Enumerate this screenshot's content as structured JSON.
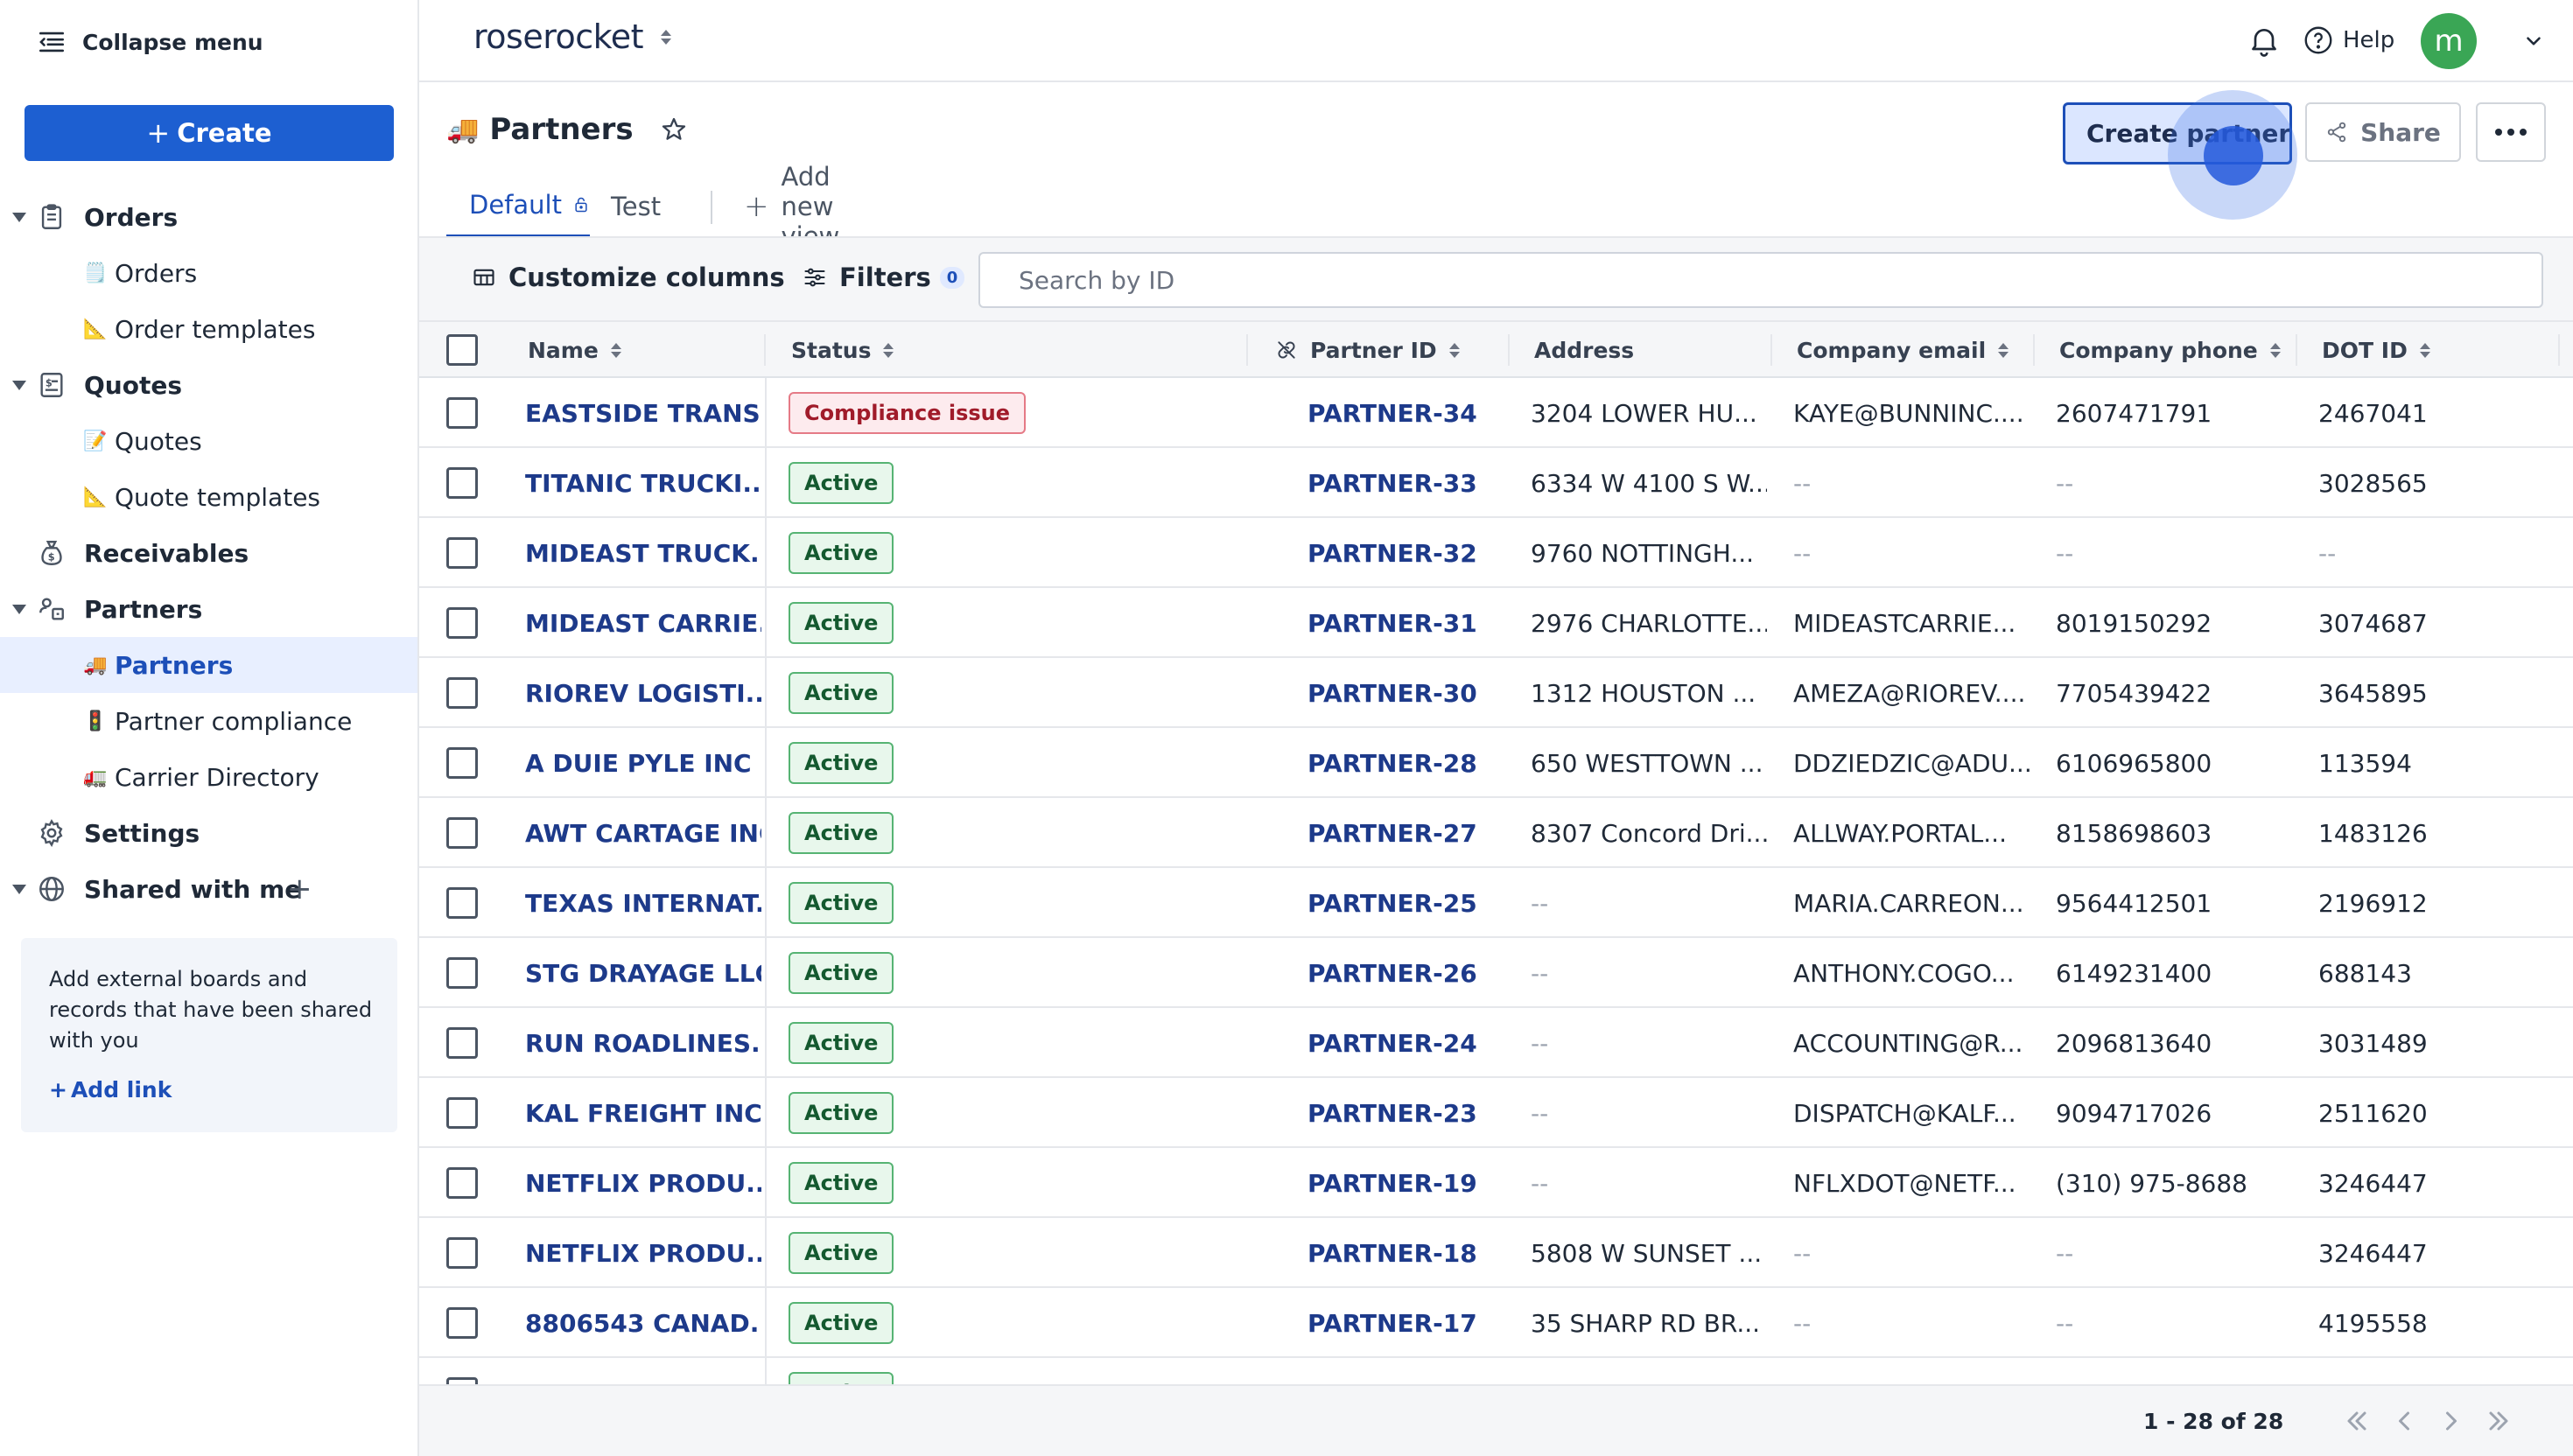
{
  "sidebar": {
    "collapse_label": "Collapse menu",
    "create_label": "Create",
    "groups": {
      "orders": {
        "label": "Orders",
        "items": [
          {
            "emoji": "🗒️",
            "label": "Orders"
          },
          {
            "emoji": "📐",
            "label": "Order templates"
          }
        ]
      },
      "quotes": {
        "label": "Quotes",
        "items": [
          {
            "emoji": "📝",
            "label": "Quotes"
          },
          {
            "emoji": "📐",
            "label": "Quote templates"
          }
        ]
      },
      "receivables": {
        "label": "Receivables"
      },
      "partners": {
        "label": "Partners",
        "items": [
          {
            "emoji": "🚚",
            "label": "Partners"
          },
          {
            "emoji": "🚦",
            "label": "Partner compliance"
          },
          {
            "emoji": "🚛",
            "label": "Carrier Directory"
          }
        ]
      },
      "settings": {
        "label": "Settings"
      },
      "shared": {
        "label": "Shared with me"
      }
    },
    "shared_box": {
      "text": "Add external boards and records that have been shared with you",
      "add_link": "Add link"
    }
  },
  "topbar": {
    "brand": "roserocket",
    "help_label": "Help",
    "avatar_initial": "m",
    "avatar_color": "#3aa655"
  },
  "page": {
    "emoji": "🚚",
    "title": "Partners",
    "create_partner_label": "Create partner",
    "share_label": "Share"
  },
  "tabs": {
    "default_label": "Default",
    "test_label": "Test",
    "add_view_label": "Add new view"
  },
  "toolbar": {
    "customize_label": "Customize columns",
    "filters_label": "Filters",
    "filters_count": "0",
    "search_placeholder": "Search by ID"
  },
  "table": {
    "columns": {
      "name": "Name",
      "status": "Status",
      "partner_id": "Partner ID",
      "address": "Address",
      "email": "Company email",
      "phone": "Company phone",
      "dot": "DOT ID"
    },
    "rows": [
      {
        "name": "EASTSIDE TRANS...",
        "status": "Compliance issue",
        "status_kind": "issue",
        "partner_id": "PARTNER-34",
        "address": "3204 LOWER HU...",
        "email": "KAYE@BUNNINC....",
        "phone": "2607471791",
        "dot": "2467041"
      },
      {
        "name": "TITANIC TRUCKI...",
        "status": "Active",
        "status_kind": "active",
        "partner_id": "PARTNER-33",
        "address": "6334 W 4100 S W...",
        "email": "--",
        "phone": "--",
        "dot": "3028565"
      },
      {
        "name": "MIDEAST TRUCK...",
        "status": "Active",
        "status_kind": "active",
        "partner_id": "PARTNER-32",
        "address": "9760 NOTTINGH...",
        "email": "--",
        "phone": "--",
        "dot": "--"
      },
      {
        "name": "MIDEAST CARRIE...",
        "status": "Active",
        "status_kind": "active",
        "partner_id": "PARTNER-31",
        "address": "2976 CHARLOTTE...",
        "email": "MIDEASTCARRIE...",
        "phone": "8019150292",
        "dot": "3074687"
      },
      {
        "name": "RIOREV LOGISTI...",
        "status": "Active",
        "status_kind": "active",
        "partner_id": "PARTNER-30",
        "address": "1312 HOUSTON ...",
        "email": "AMEZA@RIOREV....",
        "phone": "7705439422",
        "dot": "3645895"
      },
      {
        "name": "A DUIE PYLE INC",
        "status": "Active",
        "status_kind": "active",
        "partner_id": "PARTNER-28",
        "address": "650 WESTTOWN ...",
        "email": "DDZIEDZIC@ADU...",
        "phone": "6106965800",
        "dot": "113594"
      },
      {
        "name": "AWT CARTAGE INC",
        "status": "Active",
        "status_kind": "active",
        "partner_id": "PARTNER-27",
        "address": "8307 Concord Dri...",
        "email": "ALLWAY.PORTAL...",
        "phone": "8158698603",
        "dot": "1483126"
      },
      {
        "name": "TEXAS INTERNAT...",
        "status": "Active",
        "status_kind": "active",
        "partner_id": "PARTNER-25",
        "address": "--",
        "email": "MARIA.CARREON...",
        "phone": "9564412501",
        "dot": "2196912"
      },
      {
        "name": "STG DRAYAGE LLC",
        "status": "Active",
        "status_kind": "active",
        "partner_id": "PARTNER-26",
        "address": "--",
        "email": "ANTHONY.COGO...",
        "phone": "6149231400",
        "dot": "688143"
      },
      {
        "name": "RUN ROADLINES...",
        "status": "Active",
        "status_kind": "active",
        "partner_id": "PARTNER-24",
        "address": "--",
        "email": "ACCOUNTING@R...",
        "phone": "2096813640",
        "dot": "3031489"
      },
      {
        "name": "KAL FREIGHT INC",
        "status": "Active",
        "status_kind": "active",
        "partner_id": "PARTNER-23",
        "address": "--",
        "email": "DISPATCH@KALF...",
        "phone": "9094717026",
        "dot": "2511620"
      },
      {
        "name": "NETFLIX PRODU...",
        "status": "Active",
        "status_kind": "active",
        "partner_id": "PARTNER-19",
        "address": "--",
        "email": "NFLXDOT@NETF...",
        "phone": "(310) 975-8688",
        "dot": "3246447"
      },
      {
        "name": "NETFLIX PRODU...",
        "status": "Active",
        "status_kind": "active",
        "partner_id": "PARTNER-18",
        "address": "5808 W SUNSET ...",
        "email": "--",
        "phone": "--",
        "dot": "3246447"
      },
      {
        "name": "8806543 CANAD...",
        "status": "Active",
        "status_kind": "active",
        "partner_id": "PARTNER-17",
        "address": "35 SHARP RD BR...",
        "email": "--",
        "phone": "--",
        "dot": "4195558"
      },
      {
        "name": "",
        "status": "Active",
        "status_kind": "active",
        "partner_id": "",
        "address": "",
        "email": "",
        "phone": "",
        "dot": ""
      }
    ]
  },
  "footer": {
    "page_count": "1 - 28 of 28"
  },
  "colors": {
    "primary": "#1d5fd1",
    "link": "#1d3a8a",
    "active_text": "#14592f",
    "issue_text": "#a01b2a"
  }
}
